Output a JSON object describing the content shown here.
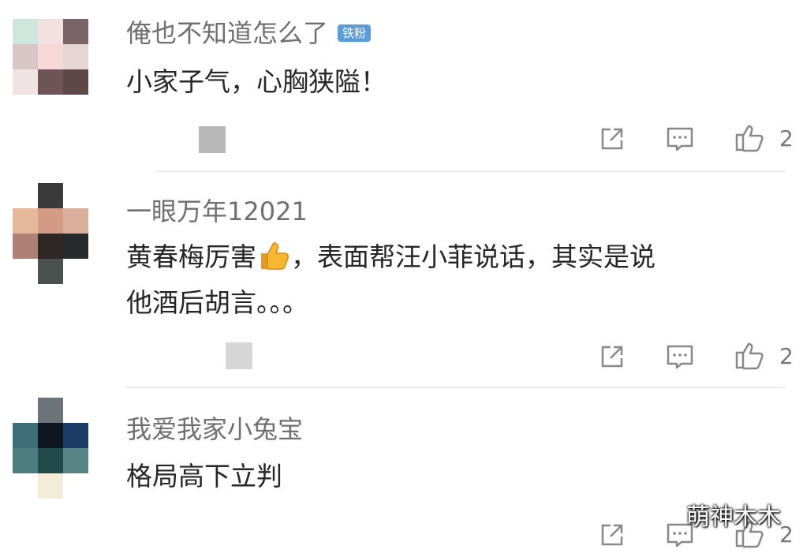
{
  "comments": [
    {
      "username": "俺也不知道怎么了",
      "badge": "铁粉",
      "text": "小家子气，心胸狭隘！",
      "like_count": "2"
    },
    {
      "username": "一眼万年12021",
      "text_part1": "黄春梅厉害",
      "text_part2": "，表面帮汪小菲说话，其实是说",
      "text_line2": "他酒后胡言。。。",
      "like_count": "2"
    },
    {
      "username": "我爱我家小兔宝",
      "text": "格局高下立判",
      "like_count": "2"
    }
  ],
  "icons": {
    "share": "share-icon",
    "comment": "comment-icon",
    "like": "thumbs-up-icon",
    "emoji": "thumbs-up-emoji"
  },
  "colors": {
    "badge": "#5b9bd8",
    "username": "#6f6f6f",
    "text": "#262626"
  },
  "watermark": "萌神木木"
}
